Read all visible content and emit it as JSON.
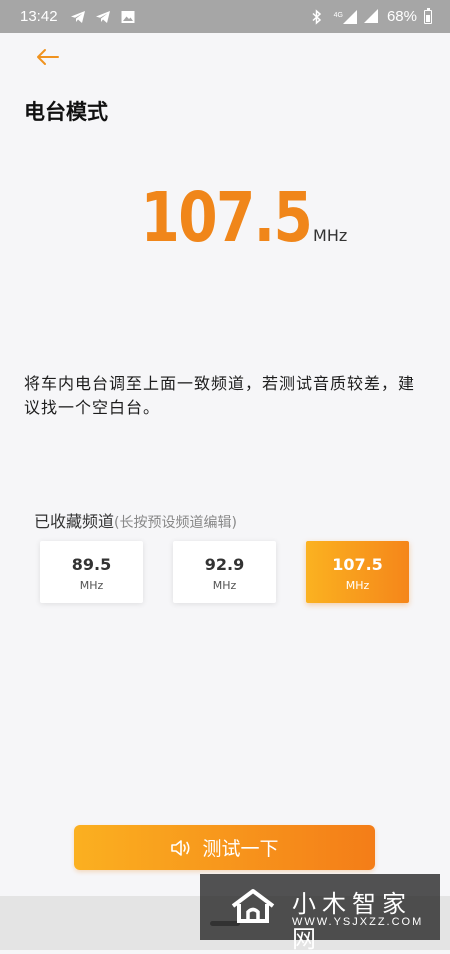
{
  "status_bar": {
    "time": "13:42",
    "network_label": "4G",
    "battery": "68%",
    "left_icons": [
      "telegram-icon",
      "telegram-icon",
      "image-icon"
    ],
    "right_icons": [
      "bluetooth-icon",
      "signal-icon",
      "signal-icon",
      "battery-icon"
    ]
  },
  "header": {
    "back_icon": "arrow-left-icon",
    "title": "电台模式"
  },
  "frequency": {
    "value": "107.5",
    "unit": "MHz"
  },
  "instruction": "将车内电台调至上面一致频道，若测试音质较差，建议找一个空白台。",
  "favorites": {
    "title": "已收藏频道",
    "hint": "(长按预设频道编辑)",
    "channels": [
      {
        "value": "89.5",
        "unit": "MHz",
        "selected": false
      },
      {
        "value": "92.9",
        "unit": "MHz",
        "selected": false
      },
      {
        "value": "107.5",
        "unit": "MHz",
        "selected": true
      }
    ]
  },
  "test_button": {
    "label": "测试一下",
    "icon": "speaker-icon"
  },
  "watermark": {
    "name": "小木智家网",
    "url": "WWW.YSJXZZ.COM"
  },
  "colors": {
    "accent": "#f0861a",
    "gradient_start": "#fbb020",
    "gradient_end": "#f47d18",
    "background": "#f6f6f8"
  }
}
